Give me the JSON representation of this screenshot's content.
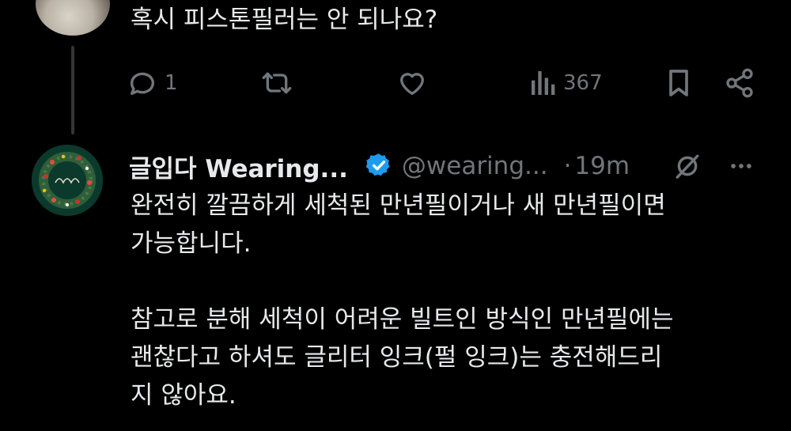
{
  "previous_tweet": {
    "text": "혹시 피스톤필러는 안 되나요?",
    "actions": {
      "reply_count": "1",
      "retweet_count": "",
      "like_count": "",
      "views_count": "367"
    }
  },
  "reply_tweet": {
    "author_name": "글입다 Wearing...",
    "author_handle": "@wearing...",
    "separator": "·",
    "timestamp": "19m",
    "verified": true,
    "lines": [
      "완전히 깔끔하게 세척된 만년필이거나 새 만년필이면",
      "가능합니다.",
      "",
      "참고로 분해 세척이 어려운 빌트인 방식인 만년필에는",
      "괜찮다고 하셔도 글리터 잉크(펄 잉크)는 충전해드리",
      "지 않아요."
    ]
  },
  "icons": {
    "reply": "reply-icon",
    "retweet": "retweet-icon",
    "like": "heart-icon",
    "views": "views-icon",
    "bookmark": "bookmark-icon",
    "share": "share-icon",
    "verified": "verified-badge-icon",
    "grok": "grok-icon",
    "more": "more-icon"
  },
  "colors": {
    "background": "#000000",
    "text": "#e7e9ea",
    "secondary": "#71767b",
    "verified_blue": "#1d9bf0"
  }
}
